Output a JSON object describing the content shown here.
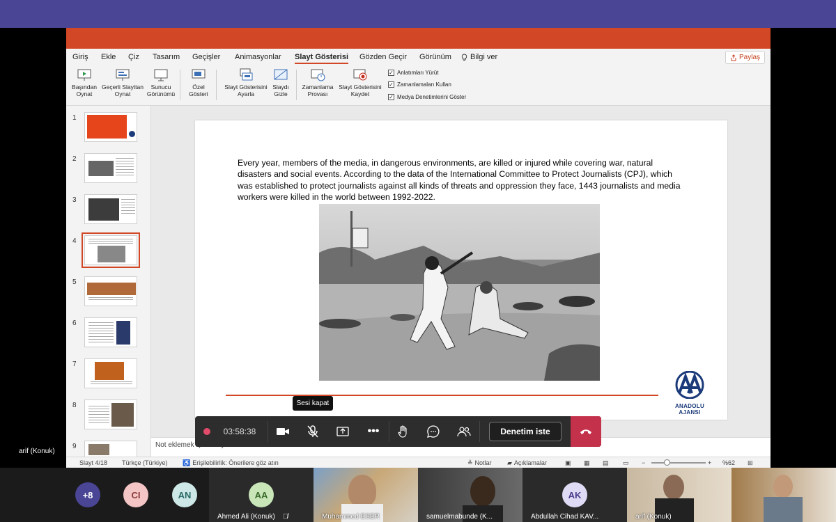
{
  "ribbon_tabs": [
    "Giriş",
    "Ekle",
    "Çiz",
    "Tasarım",
    "Geçişler",
    "Animasyonlar",
    "Slayt Gösterisi",
    "Gözden Geçir",
    "Görünüm",
    "Bilgi ver"
  ],
  "share_label": "Paylaş",
  "ribbon_buttons": {
    "from_beginning": "Başından Oynat",
    "from_current": "Geçerli Slayttan Oynat",
    "presenter_view": "Sunucu Görünümü",
    "custom_show": "Özel Gösteri",
    "setup_show": "Slayt Gösterisini Ayarla",
    "hide_slide": "Slaydı Gizle",
    "rehearse_timings": "Zamanlama Provası",
    "record_show": "Slayt Gösterisini Kaydet"
  },
  "ribbon_checks": [
    "Anlatımları Yürüt",
    "Zamanlamaları Kullan",
    "Medya Denetimlerini Göster"
  ],
  "thumbnails": [
    "1",
    "2",
    "3",
    "4",
    "5",
    "6",
    "7",
    "8",
    "9"
  ],
  "slide": {
    "body": "Every year, members of the media, in dangerous environments, are killed or injured while covering war, natural disasters and social events. According to the data of the International Committee to Protect Journalists (CPJ), which was established to protect journalists against all kinds of threats and oppression they face, 1443 journalists and media workers were killed in the world between 1992-2022.",
    "logo_text": "ANADOLU AJANSI"
  },
  "notes_placeholder": "Not eklemek için tıklayın",
  "status": {
    "slide_count": "Slayt 4/18",
    "language": "Türkçe (Türkiye)",
    "accessibility": "Erişilebilirlik: Önerilere göz atın",
    "notes": "Notlar",
    "comments": "Açıklamalar",
    "zoom": "%62"
  },
  "call": {
    "timer": "03:58:38",
    "tooltip": "Sesi kapat",
    "request_control": "Denetim iste"
  },
  "local_label": "arif (Konuk)",
  "participants": [
    {
      "initials": "+8",
      "color": "#4a4594"
    },
    {
      "initials": "CI",
      "color": "#f3c5c5"
    },
    {
      "initials": "AN",
      "color": "#cde8e6"
    },
    {
      "initials": "AA",
      "name": "Ahmed Ali (Konuk)",
      "color": "#c9e6b9"
    },
    {
      "name": "Muhammed ESER"
    },
    {
      "name": "samuelmabunde (K..."
    },
    {
      "initials": "AK",
      "name": "Abdullah Cihad KAV...",
      "color": "#e0dbf5"
    },
    {
      "name": "arif (Konuk)"
    }
  ]
}
